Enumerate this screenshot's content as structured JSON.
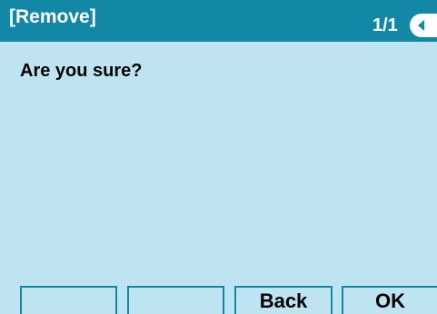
{
  "header": {
    "title": "[Remove]",
    "page_indicator": "1/1",
    "scroll_icon": "left-arrow-tab-icon"
  },
  "main": {
    "message": "Are you sure?"
  },
  "softkeys": [
    {
      "label": ""
    },
    {
      "label": ""
    },
    {
      "label": "Back"
    },
    {
      "label": "OK"
    }
  ],
  "colors": {
    "title_bar": "#1387a6",
    "background": "#bfe4f1",
    "text": "#000000"
  }
}
